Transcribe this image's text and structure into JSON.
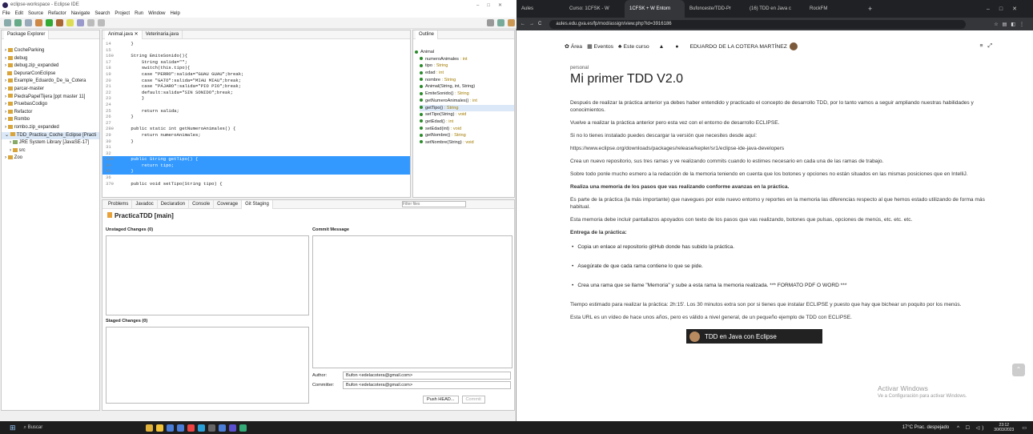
{
  "eclipse": {
    "title": "eclipse-workspace - Eclipse IDE",
    "menu": [
      "File",
      "Edit",
      "Source",
      "Refactor",
      "Navigate",
      "Search",
      "Project",
      "Run",
      "Window",
      "Help"
    ],
    "package_explorer": {
      "tab": "Package Explorer",
      "items": [
        "CocheParking",
        "debug",
        "debug.zip_expanded",
        "DepurarConEclipse",
        "Example_Eduardo_De_la_Cotera",
        "parcar-master",
        "PiedraPapelTijera [ppt master 11]",
        "PruebasCodigo",
        "Refactor",
        "Rombo",
        "rombo.zip_expanded",
        "TDD_Practica_Coche_Eclipse [Practi",
        "JRE System Library [JavaSE-17]",
        "src",
        "Zoo"
      ]
    },
    "editor": {
      "tabs": [
        "Animal.java",
        "Veterinaria.java"
      ],
      "lines": [
        {
          "n": "14",
          "t": "    }"
        },
        {
          "n": "15",
          "t": ""
        },
        {
          "n": "16⊖",
          "t": "    String EmiteSonido(){"
        },
        {
          "n": "17",
          "t": "        String salida=\"\";"
        },
        {
          "n": "18",
          "t": "        switch(this.tipo){"
        },
        {
          "n": "19",
          "t": "        case \"PERRO\":salida=\"GUAU GUAU\";break;"
        },
        {
          "n": "20",
          "t": "        case \"GATO\":salida=\"MIAU MIAU\";break;"
        },
        {
          "n": "21",
          "t": "        case \"PÁJARO\":salida=\"PIO PIO\";break;"
        },
        {
          "n": "22",
          "t": "        default:salida=\"SIN SONIDO\";break;"
        },
        {
          "n": "23",
          "t": "        }"
        },
        {
          "n": "24",
          "t": ""
        },
        {
          "n": "25",
          "t": "        return salida;"
        },
        {
          "n": "26",
          "t": "    }"
        },
        {
          "n": "27",
          "t": ""
        },
        {
          "n": "28⊖",
          "t": "    public static int getNumeroAnimales() {"
        },
        {
          "n": "29",
          "t": "        return numeroAnimales;"
        },
        {
          "n": "30",
          "t": "    }"
        },
        {
          "n": "31",
          "t": ""
        },
        {
          "n": "32",
          "t": ""
        },
        {
          "n": "33⊖",
          "t": "    public String getTipo() {",
          "hl": true
        },
        {
          "n": "34",
          "t": "        return tipo;",
          "hl": true
        },
        {
          "n": "35",
          "t": "    }",
          "hl": true
        },
        {
          "n": "36",
          "t": ""
        },
        {
          "n": "37⊖",
          "t": "    public void setTipo(String tipo) {"
        }
      ]
    },
    "outline": {
      "tab": "Outline",
      "items": [
        {
          "name": "Animal",
          "type": ""
        },
        {
          "name": "numeroAnimales",
          "type": " : int"
        },
        {
          "name": "tipo",
          "type": " : String"
        },
        {
          "name": "edad",
          "type": " : int"
        },
        {
          "name": "nombre",
          "type": " : String"
        },
        {
          "name": "Animal(String, int, String)",
          "type": ""
        },
        {
          "name": "EmiteSonido()",
          "type": " : String"
        },
        {
          "name": "getNumeroAnimales()",
          "type": " : int"
        },
        {
          "name": "getTipo()",
          "type": " : String"
        },
        {
          "name": "setTipo(String)",
          "type": " : void"
        },
        {
          "name": "getEdad()",
          "type": " : int"
        },
        {
          "name": "setEdad(int)",
          "type": " : void"
        },
        {
          "name": "getNombre()",
          "type": " : String"
        },
        {
          "name": "setNombre(String)",
          "type": " : void"
        }
      ]
    },
    "bottom_tabs": [
      "Problems",
      "Javadoc",
      "Declaration",
      "Console",
      "Coverage",
      "Git Staging"
    ],
    "filter_placeholder": "Filter files",
    "staging": {
      "repo": "PracticaTDD [main]",
      "unstaged": "Unstaged Changes (0)",
      "staged": "Staged Changes (0)",
      "commit_message": "Commit Message",
      "author_label": "Author:",
      "author": "Bufon <edelacotera@gmail.com>",
      "committer_label": "Committer:",
      "committer": "Bufon <edelacotera@gmail.com>",
      "push": "Push HEAD...",
      "commit": "Commit"
    }
  },
  "chrome": {
    "tabs": [
      "Aules",
      "Curso: 1CFSK - W",
      "1CFSK + W Entorn",
      "Bufonceste/TDD-Pr",
      "(16) TDD en Java c",
      "RockFM"
    ],
    "url": "aules.edu.gva.es/fp/mod/assign/view.php?id=3916186",
    "nav": {
      "area": "Área",
      "eventos": "Eventos",
      "curso": "Este curso",
      "user": "EDUARDO DE LA COTERA MARTÍNEZ"
    },
    "doc": {
      "tag": "personal",
      "title": "Mi primer TDD V2.0",
      "p1": "Después de realizar la práctica anterior ya debes haber entendido y practicado el concepto de desarrollo TDD, por lo tanto vamos a seguir ampliando nuestras habilidades y conocimientos.",
      "p2": "Vuelve a realizar la práctica anterior pero esta vez con el entorno de desarrollo ECLIPSE.",
      "p3": "Si no lo tienes instalado puedes descargar la versión que necesites desde aquí:",
      "p4": "https://www.eclipse.org/downloads/packages/release/kepler/sr1/eclipse-ide-java-developers",
      "p5": "Crea un nuevo repositorio, sus tres ramas y ve realizando commits cuando lo estimes necesario en cada una de las ramas de trabajo.",
      "p6": "Sobre todo ponle mucho esmero a la redacción de la memoria teniendo en cuenta que los botones y opciones no están situados en las mismas posiciones que en IntelliJ.",
      "p7": "Realiza una memoria de los pasos que vas realizando conforme avanzas en la práctica.",
      "p8": "Es parte de la práctica (la más importante) que navegues por este nuevo entorno y reportes en la memoria las diferencias respecto al que hemos estado utilizando de forma más habitual.",
      "p9": "Esta memoria debe incluir pantallazos apoyados con texto de los pasos que vas realizando, botones que pulsas, opciones de menús, etc. etc. etc.",
      "p10": "Entrega de la práctica:",
      "li1": "Copia un enlace al repositorio gitHub donde has subido la práctica.",
      "li2": "Asegúrate de que cada rama contiene lo que se pide.",
      "li3": "Crea una rama que se llame \"Memoria\" y sube a esta rama la memoria realizada. *** FORMATO PDF O WORD ***",
      "p11": "Tiempo estimado para realizar la práctica: 2h:15'. Los 30 minutos extra son por si tienes que instalar ECLIPSE y puesto que hay que bichear un poquito por los menús.",
      "p12": "Esta URL es un vídeo de hace unos años, pero es válido a nivel general, de un pequeño ejemplo de TDD con ECLIPSE.",
      "video": "TDD en Java con Eclipse",
      "activate1": "Activar Windows",
      "activate2": "Ve a Configuración para activar Windows."
    }
  },
  "taskbar": {
    "search": "Buscar",
    "weather": "17°C  Prac. despejado",
    "time": "23:12",
    "date": "30/03/2023"
  }
}
